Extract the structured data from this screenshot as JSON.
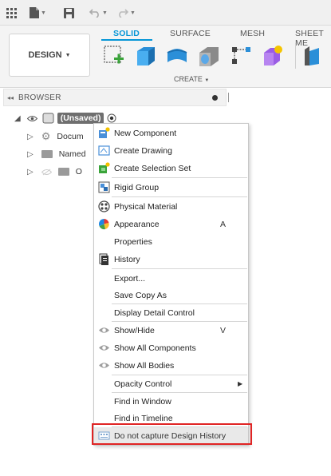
{
  "ribbon": {
    "design_label": "DESIGN",
    "tabs": [
      {
        "label": "SOLID",
        "active": true
      },
      {
        "label": "SURFACE",
        "active": false
      },
      {
        "label": "MESH",
        "active": false
      },
      {
        "label": "SHEET ME",
        "active": false
      }
    ],
    "create_label": "CREATE"
  },
  "browser": {
    "title": "BROWSER",
    "root_label": "(Unsaved)",
    "rows": [
      {
        "label": "Docum"
      },
      {
        "label": "Named"
      },
      {
        "label": "O"
      }
    ]
  },
  "context_menu": {
    "items": [
      {
        "label": "New Component",
        "icon": "new-component-icon"
      },
      {
        "label": "Create Drawing",
        "icon": "create-drawing-icon"
      },
      {
        "label": "Create Selection Set",
        "icon": "selection-set-icon"
      },
      {
        "label": "Rigid Group",
        "icon": "rigid-group-icon"
      },
      {
        "label": "Physical Material",
        "icon": "physical-material-icon"
      },
      {
        "label": "Appearance",
        "icon": "appearance-icon",
        "shortcut": "A"
      },
      {
        "label": "Properties"
      },
      {
        "label": "History",
        "icon": "history-icon"
      },
      {
        "label": "Export..."
      },
      {
        "label": "Save Copy As"
      },
      {
        "label": "Display Detail Control"
      },
      {
        "label": "Show/Hide",
        "icon": "eye-icon",
        "shortcut": "V"
      },
      {
        "label": "Show All Components",
        "icon": "eye-icon"
      },
      {
        "label": "Show All Bodies",
        "icon": "eye-icon"
      },
      {
        "label": "Opacity Control",
        "submenu": true
      },
      {
        "label": "Find in Window"
      },
      {
        "label": "Find in Timeline"
      },
      {
        "label": "Do not capture Design History",
        "icon": "design-history-icon",
        "highlighted": true
      }
    ]
  },
  "colors": {
    "accent": "#0696d7",
    "highlight_box": "#e02424"
  }
}
